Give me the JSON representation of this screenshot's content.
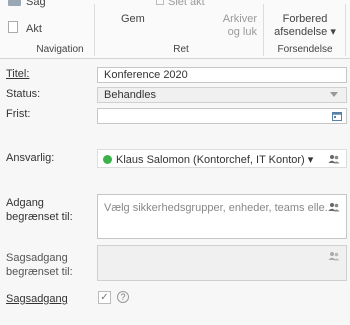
{
  "ribbon": {
    "sag": "Sag",
    "akt": "Akt",
    "gem": "Gem",
    "slet_akt": "Slet akt",
    "arkiver_line1": "Arkiver",
    "arkiver_line2": "og luk",
    "forbered_line1": "Forbered",
    "forbered_line2": "afsendelse ▾",
    "groups": {
      "navigation": "Navigation",
      "ret": "Ret",
      "forsendelse": "Forsendelse"
    }
  },
  "form": {
    "titel_label": "Titel:",
    "titel_value": "Konference 2020",
    "status_label": "Status:",
    "status_value": "Behandles",
    "frist_label": "Frist:",
    "frist_value": "",
    "ansvarlig_label": "Ansvarlig:",
    "ansvarlig_value": "Klaus Salomon (Kontorchef, IT Kontor) ▾",
    "adgang_label_1": "Adgang",
    "adgang_label_2": "begrænset til:",
    "adgang_placeholder": "Vælg sikkerhedsgrupper, enheder, teams elle...",
    "sagsadgang_label_1": "Sagsadgang",
    "sagsadgang_label_2": "begrænset til:",
    "sagsadgang_check_label": "Sagsadgang",
    "help_glyph": "?",
    "checkmark_glyph": "✓"
  },
  "colors": {
    "ansvarlig_status": "#3bb34a",
    "accent": "#2b6cb0"
  }
}
